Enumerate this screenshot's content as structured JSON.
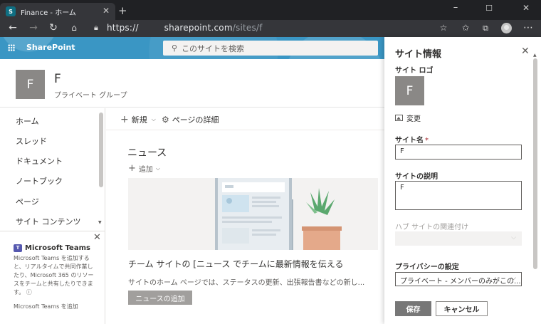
{
  "browser": {
    "tab_favicon": "S",
    "tab_title": "Finance - ホーム",
    "tab_close": "✕",
    "new_tab": "+",
    "address_scheme": "https://",
    "address_host": "sharepoint.com",
    "address_path": "/sites/f",
    "icons": [
      "back-icon",
      "forward-icon",
      "refresh-icon",
      "home-icon",
      "lock-icon",
      "favorite-icon",
      "favorites-icon",
      "collections-icon",
      "profile-icon",
      "more-icon"
    ]
  },
  "suite": {
    "brand": "SharePoint",
    "search_placeholder": "このサイトを検索"
  },
  "site": {
    "logo_letter": "F",
    "name": "F",
    "subtitle": "プライベート グループ"
  },
  "nav": {
    "items": [
      "ホーム",
      "スレッド",
      "ドキュメント",
      "ノートブック",
      "ページ",
      "サイト コンテンツ"
    ]
  },
  "teams_promo": {
    "title": "Microsoft Teams",
    "body": "Microsoft Teams を追加すると、リアルタイムで共同作業し たり、Microsoft 365 のリソースをチームと共有したりできます。",
    "link": "Microsoft Teams を追加"
  },
  "commandbar": {
    "new_label": "新規",
    "details_label": "ページの詳細"
  },
  "news": {
    "heading": "ニュース",
    "add_label": "追加",
    "title": "チーム サイトの [ニュース でチームに最新情報を伝える",
    "description": "サイトのホーム ページでは、ステータスの更新、出張報告書などの新し...",
    "button": "ニュースの追加"
  },
  "panel": {
    "title": "サイト情報",
    "logo_label": "サイト ロゴ",
    "logo_letter": "F",
    "change_label": "変更",
    "name_label": "サイト名",
    "name_required": "*",
    "name_value": "F",
    "desc_label": "サイトの説明",
    "desc_value": "F",
    "hub_label": "ハブ サイトの関連付け",
    "privacy_label": "プライバシーの設定",
    "privacy_value": "プライベート - メンバーのみがこの...",
    "save": "保存",
    "cancel": "キャンセル"
  },
  "colors": {
    "suitebar": "#3a96c4",
    "chrome_dark": "#202124",
    "save_button": "#777777"
  }
}
